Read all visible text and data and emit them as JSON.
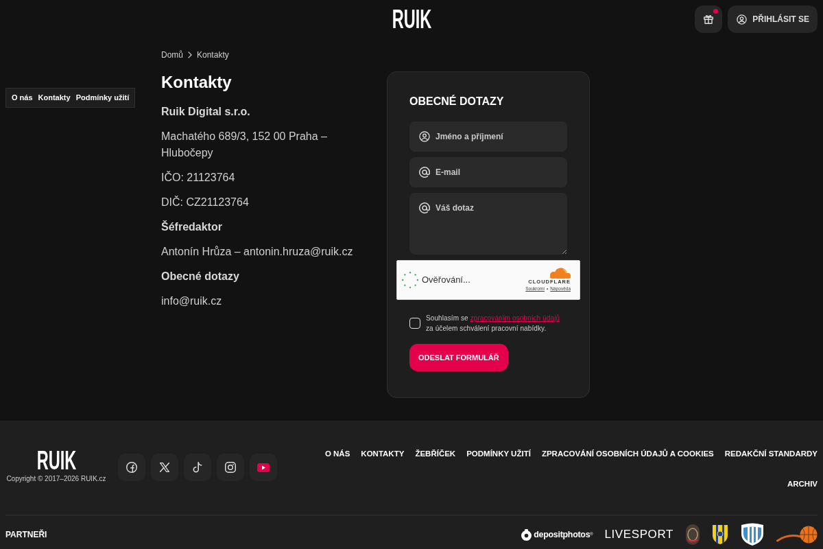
{
  "header": {
    "logo": "RUIK",
    "gift_notification": true,
    "login_label": "PŘIHLÁSIT SE"
  },
  "page_links": [
    "O nás",
    "Kontakty",
    "Podmínky užití"
  ],
  "breadcrumb": [
    {
      "label": "Domů"
    },
    {
      "label": "Kontakty"
    }
  ],
  "title": "Kontakty",
  "contact": [
    {
      "kind": "heading",
      "text": "Ruik Digital s.r.o."
    },
    {
      "kind": "text",
      "text": "Machatého 689/3, 152 00 Praha – Hlubočepy"
    },
    {
      "kind": "text",
      "text": "IČO: 21123764"
    },
    {
      "kind": "text",
      "text": "DIČ: CZ21123764"
    },
    {
      "kind": "heading",
      "text": "Šéfredaktor"
    },
    {
      "kind": "text",
      "text": "Antonín Hrůza – antonin.hruza@ruik.cz"
    },
    {
      "kind": "heading",
      "text": "Obecné dotazy"
    },
    {
      "kind": "text",
      "text": "info@ruik.cz"
    }
  ],
  "form": {
    "title": "OBECNÉ DOTAZY",
    "fields": [
      {
        "kind": "name",
        "placeholder": "Jméno a příjmení"
      },
      {
        "kind": "email",
        "placeholder": "E-mail"
      },
      {
        "kind": "message",
        "placeholder": "Váš dotaz"
      }
    ],
    "captcha": {
      "status": "Ověřování...",
      "brand": "CLOUDFLARE",
      "links": [
        "Soukromí",
        "Nápověda"
      ],
      "separator": "•"
    },
    "consent": {
      "checked": false,
      "before": "Souhlasím se",
      "link": "zpracováním osobních údajů",
      "after": "za účelem schválení pracovní nabídky."
    },
    "submit": "ODESLAT FORMULÁŘ"
  },
  "footer": {
    "logo": "RUIK",
    "copyright": "Copyright © 2017–2026 RUIK.cz",
    "socials": [
      {
        "kind": "facebook"
      },
      {
        "kind": "x"
      },
      {
        "kind": "tiktok"
      },
      {
        "kind": "instagram"
      },
      {
        "kind": "youtube"
      }
    ],
    "links": [
      "O NÁS",
      "KONTAKTY",
      "ŽEBŘÍČEK",
      "PODMÍNKY UŽITÍ",
      "ZPRACOVÁNÍ OSOBNÍCH ÚDAJŮ A COOKIES",
      "REDAKČNÍ STANDARDY",
      "ARCHIV"
    ],
    "partners_title": "PARTNEŘI",
    "partners": [
      {
        "kind": "depositphotos",
        "text": "depositphotos$^{®}$"
      },
      {
        "kind": "livesport",
        "text": "LIVESPORT"
      },
      {
        "kind": "round-badge"
      },
      {
        "kind": "striped-shield"
      },
      {
        "kind": "fct-shield"
      },
      {
        "kind": "basketball"
      }
    ]
  }
}
